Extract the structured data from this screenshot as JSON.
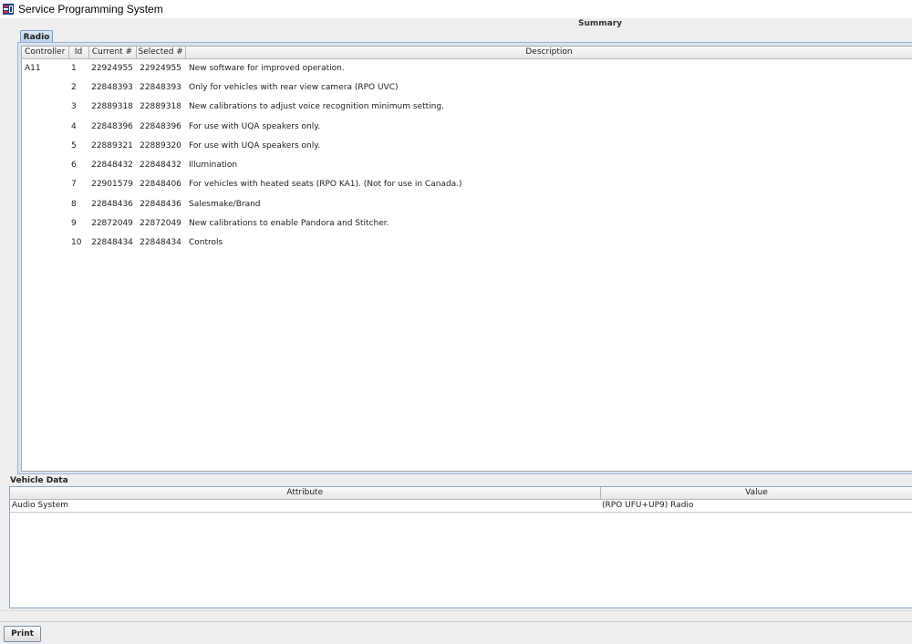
{
  "window": {
    "title": "Service Programming System"
  },
  "summary": {
    "title": "Summary"
  },
  "tabs": [
    {
      "label": "Radio"
    }
  ],
  "main_table": {
    "columns": [
      "Controller",
      "Id",
      "Current #",
      "Selected #",
      "Description"
    ],
    "rows": [
      {
        "controller": "A11",
        "id": "1",
        "current": "22924955",
        "selected": "22924955",
        "description": "New software for improved operation."
      },
      {
        "controller": "",
        "id": "2",
        "current": "22848393",
        "selected": "22848393",
        "description": "Only for vehicles with rear view camera (RPO UVC)"
      },
      {
        "controller": "",
        "id": "3",
        "current": "22889318",
        "selected": "22889318",
        "description": "New calibrations to adjust voice recognition minimum setting."
      },
      {
        "controller": "",
        "id": "4",
        "current": "22848396",
        "selected": "22848396",
        "description": "For use with UQA speakers only."
      },
      {
        "controller": "",
        "id": "5",
        "current": "22889321",
        "selected": "22889320",
        "description": "For use with UQA speakers only."
      },
      {
        "controller": "",
        "id": "6",
        "current": "22848432",
        "selected": "22848432",
        "description": "Illumination"
      },
      {
        "controller": "",
        "id": "7",
        "current": "22901579",
        "selected": "22848406",
        "description": "For vehicles with heated seats (RPO KA1). (Not for use in Canada.)"
      },
      {
        "controller": "",
        "id": "8",
        "current": "22848436",
        "selected": "22848436",
        "description": "Salesmake/Brand"
      },
      {
        "controller": "",
        "id": "9",
        "current": "22872049",
        "selected": "22872049",
        "description": "New calibrations to enable Pandora and Stitcher."
      },
      {
        "controller": "",
        "id": "10",
        "current": "22848434",
        "selected": "22848434",
        "description": "Controls"
      }
    ]
  },
  "vehicle_data": {
    "title": "Vehicle Data",
    "columns": [
      "Attribute",
      "Value"
    ],
    "rows": [
      {
        "attribute": "Audio System",
        "value": "(RPO UFU+UP9) Radio"
      }
    ]
  },
  "footer": {
    "print_label": "Print"
  },
  "colors": {
    "tab_border": "#7a9cc2",
    "panel_border": "#9bb4cf",
    "header_bg": "#e6e6e6"
  }
}
